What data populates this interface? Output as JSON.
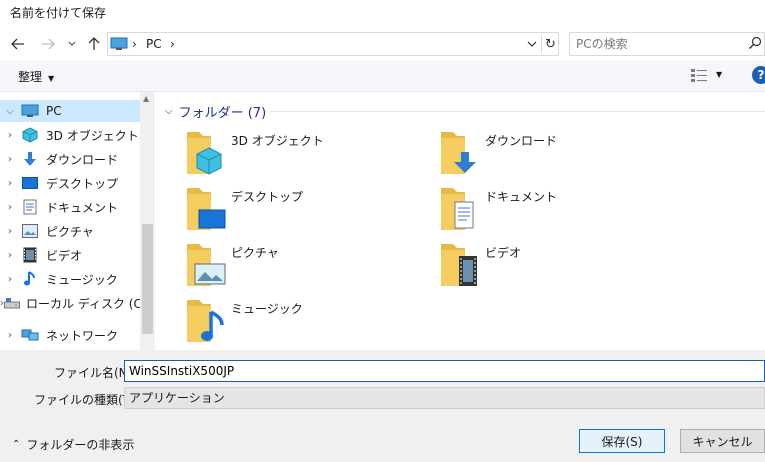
{
  "window": {
    "title": "名前を付けて保存"
  },
  "address": {
    "back_icon": "back-arrow-icon",
    "forward_icon": "forward-arrow-icon",
    "crumb_sep": "›",
    "crumb_pc": "PC",
    "crumb_sep2": "›",
    "refresh": "↻",
    "search_placeholder": "PCの検索"
  },
  "toolbar": {
    "organize": "整理",
    "help": "?"
  },
  "sidebar": {
    "items": [
      {
        "label": "PC",
        "icon": "pc-icon"
      },
      {
        "label": "3D オブジェクト",
        "icon": "3d-objects-icon"
      },
      {
        "label": "ダウンロード",
        "icon": "download-icon"
      },
      {
        "label": "デスクトップ",
        "icon": "desktop-icon"
      },
      {
        "label": "ドキュメント",
        "icon": "documents-icon"
      },
      {
        "label": "ピクチャ",
        "icon": "pictures-icon"
      },
      {
        "label": "ビデオ",
        "icon": "videos-icon"
      },
      {
        "label": "ミュージック",
        "icon": "music-icon"
      },
      {
        "label": "ローカル ディスク (C",
        "icon": "disk-icon"
      },
      {
        "label": "ネットワーク",
        "icon": "network-icon"
      }
    ]
  },
  "main": {
    "group_title": "フォルダー (7)",
    "folders": [
      {
        "label": "3D オブジェクト",
        "icon": "3d-objects-folder-icon"
      },
      {
        "label": "ダウンロード",
        "icon": "downloads-folder-icon"
      },
      {
        "label": "デスクトップ",
        "icon": "desktop-folder-icon"
      },
      {
        "label": "ドキュメント",
        "icon": "documents-folder-icon"
      },
      {
        "label": "ピクチャ",
        "icon": "pictures-folder-icon"
      },
      {
        "label": "ビデオ",
        "icon": "videos-folder-icon"
      },
      {
        "label": "ミュージック",
        "icon": "music-folder-icon"
      }
    ]
  },
  "bottom": {
    "filename_label": "ファイル名(N):",
    "filename_value": "WinSSInstiX500JP",
    "filetype_label": "ファイルの種類(T):",
    "filetype_value": "アプリケーション",
    "hide_folders": "フォルダーの非表示",
    "save": "保存(S)",
    "cancel": "キャンセル"
  },
  "colors": {
    "accent": "#0078d7",
    "selection": "#cce8ff",
    "group_header": "#1e3287",
    "folder": "#e8b94a"
  }
}
